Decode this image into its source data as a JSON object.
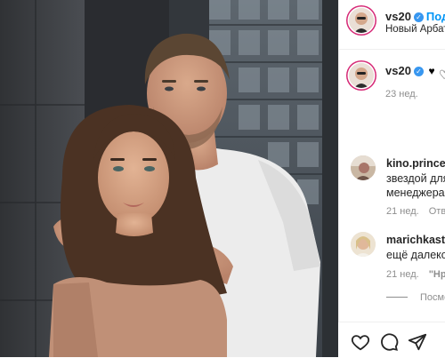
{
  "post": {
    "username": "vs20",
    "verified_badge": "✓",
    "follow_label": "Под",
    "location": "Новый Арбат, М",
    "caption_heart": "♥",
    "caption_time": "23 нед."
  },
  "comments": [
    {
      "username": "kino.princess",
      "lines": [
        "звездой для",
        "менеджера"
      ],
      "time": "21 нед.",
      "action": "Ответ"
    },
    {
      "username": "marichkastol",
      "lines": [
        "ещё далеко"
      ],
      "time": "21 нед.",
      "likes": "\"Нра"
    }
  ],
  "replies_label": "Посмот",
  "icons": {
    "like": "heart-icon",
    "comment": "comment-icon",
    "share": "share-icon"
  },
  "colors": {
    "link": "#0095f6",
    "verified": "#3897f0",
    "muted": "#8e8e8e",
    "text": "#262626"
  }
}
